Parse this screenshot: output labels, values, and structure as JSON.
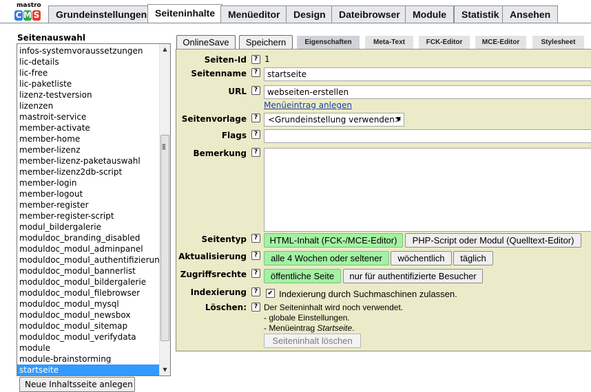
{
  "logo": {
    "top": "mastro",
    "letters": [
      "C",
      "M",
      "S"
    ],
    "letter_colors": [
      "#3a7bd5",
      "#2aa84a",
      "#e63a2a"
    ]
  },
  "tabs": [
    {
      "label": "Grundeinstellungen"
    },
    {
      "label": "Seiteninhalte"
    },
    {
      "label": "Menüeditor"
    },
    {
      "label": "Design"
    },
    {
      "label": "Dateibrowser"
    },
    {
      "label": "Module"
    },
    {
      "label": "Statistik"
    },
    {
      "label": "Ansehen"
    }
  ],
  "active_tab": "Seiteninhalte",
  "sidebar": {
    "title": "Seitenauswahl",
    "items": [
      "infos-systemvoraussetzungen",
      "lic-details",
      "lic-free",
      "lic-paketliste",
      "lizenz-testversion",
      "lizenzen",
      "mastroit-service",
      "member-activate",
      "member-home",
      "member-lizenz",
      "member-lizenz-paketauswahl",
      "member-lizenz2db-script",
      "member-login",
      "member-logout",
      "member-register",
      "member-register-script",
      "modul_bildergalerie",
      "moduldoc_branding_disabled",
      "moduldoc_modul_adminpanel",
      "moduldoc_modul_authentifizierung",
      "moduldoc_modul_bannerlist",
      "moduldoc_modul_bildergalerie",
      "moduldoc_modul_filebrowser",
      "moduldoc_modul_mysql",
      "moduldoc_modul_newsbox",
      "moduldoc_modul_sitemap",
      "moduldoc_modul_verifydata",
      "module",
      "module-brainstorming",
      "startseite"
    ],
    "selected": "startseite",
    "new_button": "Neue Inhaltsseite anlegen"
  },
  "toolbar": {
    "online_save": "OnlineSave",
    "save": "Speichern"
  },
  "subtabs": [
    {
      "label": "Eigenschaften"
    },
    {
      "label": "Meta-Text"
    },
    {
      "label": "FCK-Editor"
    },
    {
      "label": "MCE-Editor"
    },
    {
      "label": "Stylesheet"
    }
  ],
  "form": {
    "help_glyph": "?",
    "seiten_id": {
      "label": "Seiten-Id",
      "value": "1"
    },
    "seitenname": {
      "label": "Seitenname",
      "value": "startseite"
    },
    "url": {
      "label": "URL",
      "value": "webseiten-erstellen",
      "link": "Menüeintrag anlegen"
    },
    "seitenvorlage": {
      "label": "Seitenvorlage",
      "value": "<Grundeinstellung verwenden>"
    },
    "flags": {
      "label": "Flags",
      "value": ""
    },
    "bemerkung": {
      "label": "Bemerkung",
      "value": ""
    },
    "seitentyp": {
      "label": "Seitentyp",
      "options": [
        "HTML-Inhalt (FCK-/MCE-Editor)",
        "PHP-Script oder Modul (Quelltext-Editor)"
      ]
    },
    "aktualisierung": {
      "label": "Aktualisierung",
      "options": [
        "alle 4 Wochen oder seltener",
        "wöchentlich",
        "täglich"
      ]
    },
    "zugriffsrechte": {
      "label": "Zugriffsrechte",
      "options": [
        "öffentliche Seite",
        "nur für authentifizierte Besucher"
      ]
    },
    "indexierung": {
      "label": "Indexierung",
      "checked": true,
      "text": "Indexierung durch Suchmaschinen zulassen."
    },
    "loeschen": {
      "label": "Löschen:",
      "line1": "Der Seiteninhalt wird noch verwendet.",
      "line2": "- globale Einstellungen.",
      "line3_prefix": "- Menüeintrag ",
      "line3_em": "Startseite",
      "line3_suffix": ".",
      "button": "Seiteninhalt löschen"
    }
  },
  "colors": {
    "selected_option": "#a3f2a3",
    "panel_bg": "#ebebc9",
    "selection": "#3399ff",
    "link": "#1a3fa8"
  }
}
